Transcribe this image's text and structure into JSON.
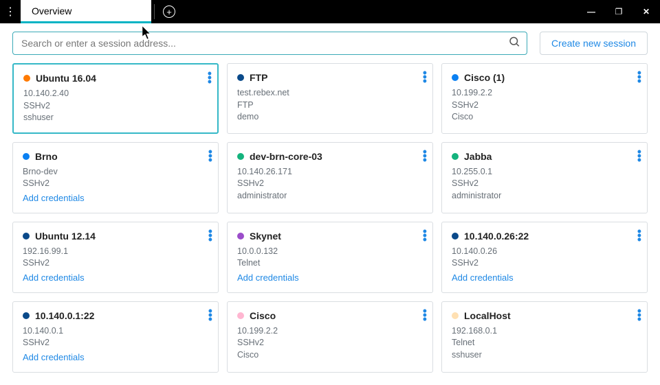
{
  "tabs": {
    "active": "Overview"
  },
  "search": {
    "placeholder": "Search or enter a session address..."
  },
  "buttons": {
    "create": "Create new session"
  },
  "cards": [
    {
      "name": "Ubuntu 16.04",
      "color": "#ff7a00",
      "host": "10.140.2.40",
      "proto": "SSHv2",
      "user": "sshuser",
      "selected": true
    },
    {
      "name": "FTP",
      "color": "#0a4a8a",
      "host": "test.rebex.net",
      "proto": "FTP",
      "user": "demo"
    },
    {
      "name": "Cisco (1)",
      "color": "#0a80f2",
      "host": "10.199.2.2",
      "proto": "SSHv2",
      "user": "Cisco"
    },
    {
      "name": "Brno",
      "color": "#0a80f2",
      "host": "Brno-dev",
      "proto": "SSHv2",
      "add_credentials": "Add credentials"
    },
    {
      "name": "dev-brn-core-03",
      "color": "#14b37d",
      "host": "10.140.26.171",
      "proto": "SSHv2",
      "user": "administrator"
    },
    {
      "name": "Jabba",
      "color": "#14b37d",
      "host": "10.255.0.1",
      "proto": "SSHv2",
      "user": "administrator"
    },
    {
      "name": "Ubuntu 12.14",
      "color": "#0a4a8a",
      "host": "192.16.99.1",
      "proto": "SSHv2",
      "add_credentials": "Add credentials"
    },
    {
      "name": "Skynet",
      "color": "#9b4dca",
      "host": "10.0.0.132",
      "proto": "Telnet",
      "add_credentials": "Add credentials"
    },
    {
      "name": "10.140.0.26:22",
      "color": "#0a4a8a",
      "host": "10.140.0.26",
      "proto": "SSHv2",
      "add_credentials": "Add credentials"
    },
    {
      "name": "10.140.0.1:22",
      "color": "#0a4a8a",
      "host": "10.140.0.1",
      "proto": "SSHv2",
      "add_credentials": "Add credentials"
    },
    {
      "name": "Cisco",
      "color": "#ffb6d1",
      "host": "10.199.2.2",
      "proto": "SSHv2",
      "user": "Cisco"
    },
    {
      "name": "LocalHost",
      "color": "#ffe0b2",
      "host": "192.168.0.1",
      "proto": "Telnet",
      "user": "sshuser"
    }
  ]
}
